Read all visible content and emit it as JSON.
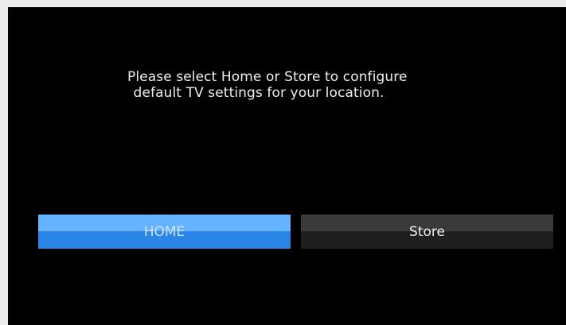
{
  "prompt": {
    "line1": "Please select Home or Store to configure",
    "line2": "default TV settings for your location."
  },
  "options": {
    "home_label": "HOME",
    "store_label": "Store",
    "selected": "HOME"
  },
  "colors": {
    "screen_background": "#000000",
    "frame_background": "#ececec",
    "home_selected_top": "#66b3ff",
    "home_selected_bottom": "#2a86e6",
    "store_top": "#3a3a3a",
    "store_bottom": "#1f1f1f",
    "text": "#eeeeee"
  }
}
